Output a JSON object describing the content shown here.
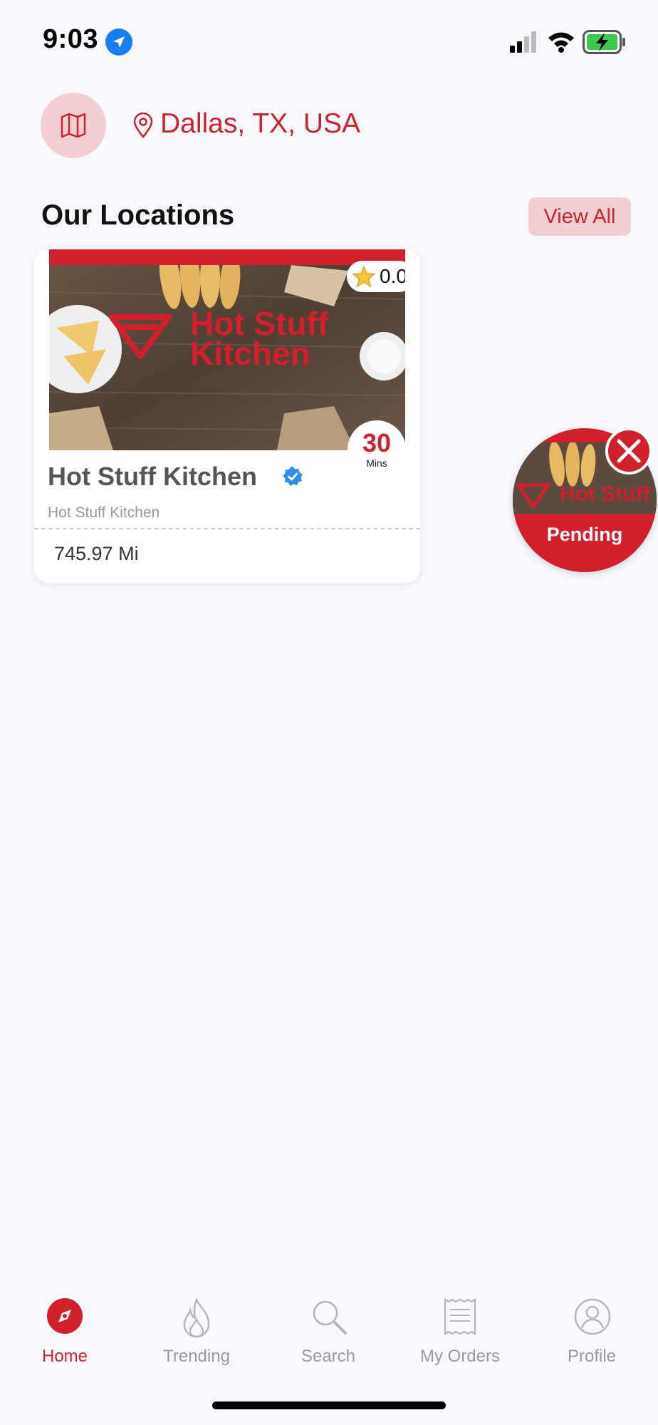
{
  "status_bar": {
    "time": "9:03",
    "icons": [
      "location-arrow-icon",
      "signal-icon",
      "wifi-icon",
      "battery-charging-icon"
    ]
  },
  "header": {
    "map_icon": "map-icon",
    "pin_icon": "map-pin-icon",
    "location": "Dallas, TX, USA"
  },
  "section": {
    "title": "Our Locations",
    "view_all_label": "View All"
  },
  "restaurant": {
    "name": "Hot Stuff Kitchen",
    "subtitle": "Hot Stuff Kitchen",
    "rating": "0.0",
    "delivery_time": "30",
    "delivery_unit": "Mins",
    "distance": "745.97 Mi",
    "verified": true,
    "logo_text_line1": "Hot Stuff",
    "logo_text_line2": "Kitchen"
  },
  "pending": {
    "label": "Pending"
  },
  "tabs": [
    {
      "label": "Home",
      "icon": "compass-icon",
      "active": true
    },
    {
      "label": "Trending",
      "icon": "flame-icon",
      "active": false
    },
    {
      "label": "Search",
      "icon": "search-icon",
      "active": false
    },
    {
      "label": "My Orders",
      "icon": "receipt-icon",
      "active": false
    },
    {
      "label": "Profile",
      "icon": "profile-icon",
      "active": false
    }
  ],
  "colors": {
    "accent": "#c9242f",
    "accent_light": "#f3cfd3",
    "background": "#f9f8fc",
    "inactive": "#9a9a9a"
  }
}
